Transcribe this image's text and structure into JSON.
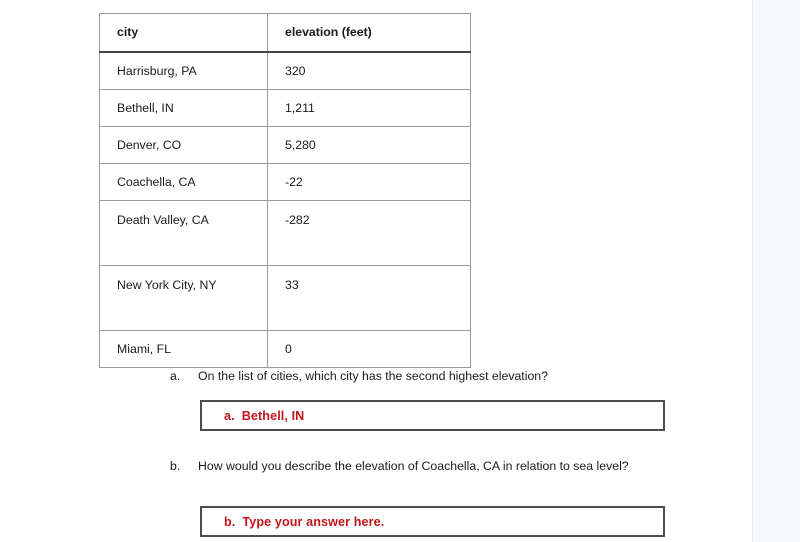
{
  "table": {
    "headers": [
      "city",
      "elevation (feet)"
    ],
    "rows": [
      {
        "city": "Harrisburg, PA",
        "elevation": "320",
        "multiline": false
      },
      {
        "city": "Bethell, IN",
        "elevation": "1,211",
        "multiline": false
      },
      {
        "city": "Denver, CO",
        "elevation": "5,280",
        "multiline": false
      },
      {
        "city": "Coachella, CA",
        "elevation": "-22",
        "multiline": false
      },
      {
        "city": "Death Valley, CA",
        "elevation": "-282",
        "multiline": true
      },
      {
        "city": "New York City, NY",
        "elevation": "33",
        "multiline": true
      },
      {
        "city": "Miami, FL",
        "elevation": "0",
        "multiline": false
      }
    ]
  },
  "questions": [
    {
      "label": "a.",
      "text": "On the list of cities, which city has the second highest elevation?",
      "answer_letter": "a.",
      "answer_value": "Bethell, IN"
    },
    {
      "label": "b.",
      "text": "How would you describe the elevation of Coachella, CA in relation to sea level?",
      "answer_letter": "b.",
      "answer_value": "Type your answer here."
    }
  ],
  "colors": {
    "answer_red": "#c3151b",
    "table_border": "#9a9a9a",
    "answer_box_border": "#4d4d4d"
  }
}
